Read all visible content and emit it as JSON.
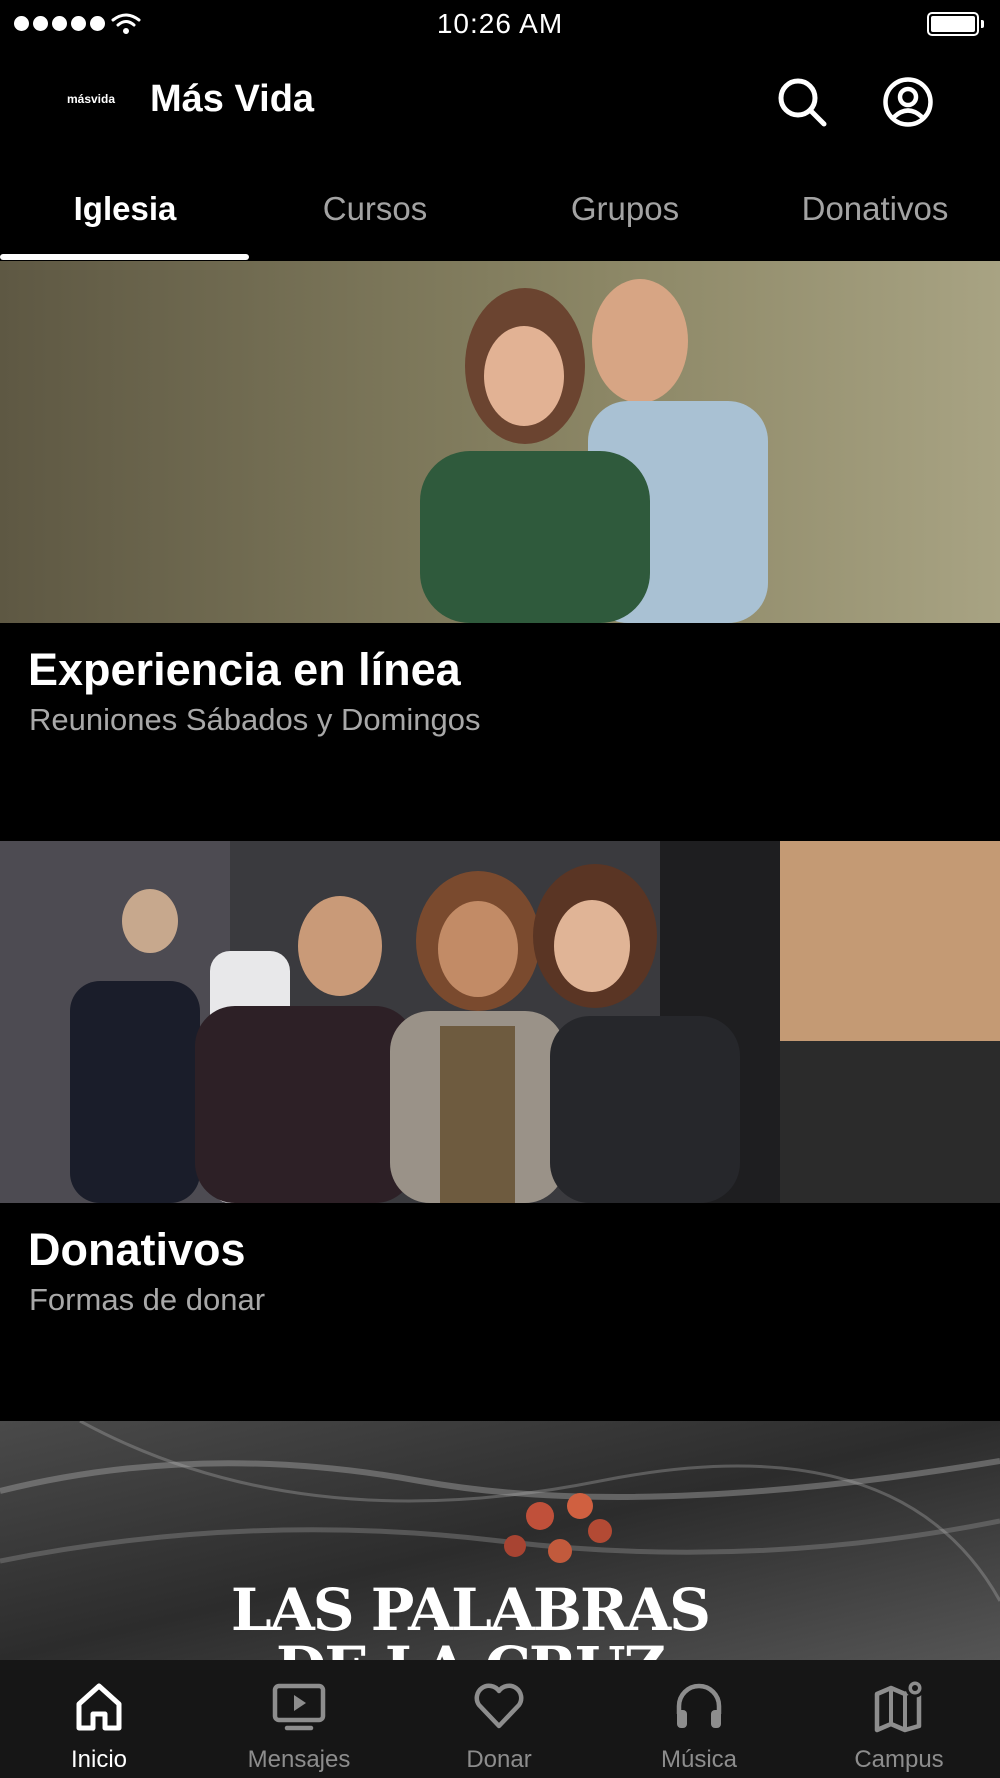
{
  "status_bar": {
    "time": "10:26 AM"
  },
  "header": {
    "logo_text": "másvida",
    "title": "Más Vida"
  },
  "tabs": [
    {
      "label": "Iglesia",
      "active": true
    },
    {
      "label": "Cursos"
    },
    {
      "label": "Grupos"
    },
    {
      "label": "Donativos"
    }
  ],
  "cards": [
    {
      "title": "Experiencia en línea",
      "subtitle": "Reuniones Sábados y Domingos"
    },
    {
      "title": "Donativos",
      "subtitle": "Formas de donar"
    },
    {
      "banner_text_line1": "LAS PALABRAS",
      "banner_text_line2": "DE LA CRUZ"
    }
  ],
  "bottom_nav": [
    {
      "label": "Inicio",
      "icon": "home-icon",
      "active": true
    },
    {
      "label": "Mensajes",
      "icon": "play-screen-icon"
    },
    {
      "label": "Donar",
      "icon": "heart-icon"
    },
    {
      "label": "Música",
      "icon": "headphones-icon"
    },
    {
      "label": "Campus",
      "icon": "map-pin-icon"
    }
  ],
  "colors": {
    "background": "#000000",
    "inactive_text": "#a3a3a3",
    "tabbar_bg": "#161616"
  }
}
